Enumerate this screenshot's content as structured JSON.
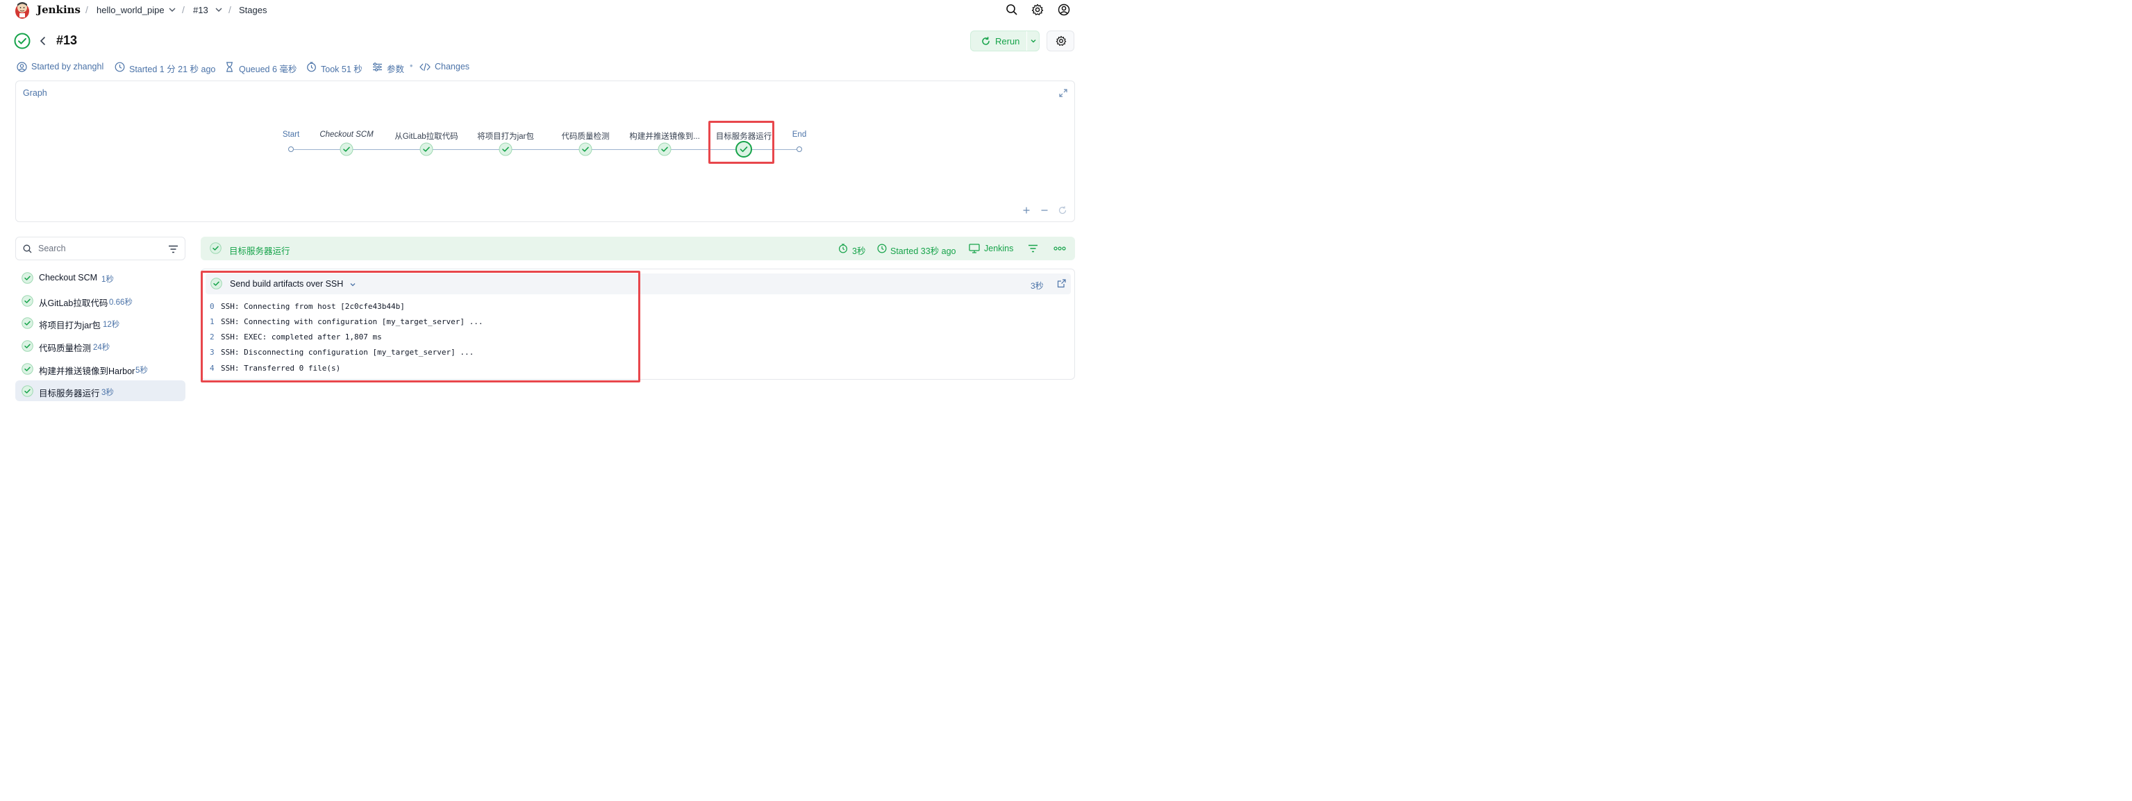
{
  "app": {
    "brand": "Jenkins",
    "breadcrumb": [
      "hello_world_pipe",
      "#13",
      "Stages"
    ]
  },
  "build": {
    "title": "#13",
    "rerun_label": "Rerun",
    "meta": {
      "started_by": "Started by zhanghl",
      "started": "Started 1 分 21 秒 ago",
      "queued": "Queued 6 毫秒",
      "took": "Took 51 秒",
      "params": "参数",
      "changes": "Changes"
    }
  },
  "graph": {
    "title": "Graph",
    "start_label": "Start",
    "end_label": "End",
    "stages": [
      {
        "label": "Checkout SCM",
        "italic": true
      },
      {
        "label": "从GitLab拉取代码"
      },
      {
        "label": "将项目打为jar包"
      },
      {
        "label": "代码质量检测"
      },
      {
        "label": "构建并推送镜像到..."
      },
      {
        "label": "目标服务器运行",
        "selected": true
      }
    ]
  },
  "sidebar": {
    "search_placeholder": "Search",
    "items": [
      {
        "name": "Checkout SCM",
        "duration": "1秒"
      },
      {
        "name": "从GitLab拉取代码",
        "duration": "0.66秒"
      },
      {
        "name": "将项目打为jar包",
        "duration": "12秒"
      },
      {
        "name": "代码质量检测",
        "duration": "24秒"
      },
      {
        "name": "构建并推送镜像到Harbor",
        "duration": "5秒"
      },
      {
        "name": "目标服务器运行",
        "duration": "3秒",
        "active": true
      }
    ]
  },
  "stage_detail": {
    "title": "目标服务器运行",
    "duration": "3秒",
    "started": "Started 33秒 ago",
    "agent": "Jenkins",
    "step": {
      "title": "Send build artifacts over SSH",
      "duration": "3秒",
      "log": [
        {
          "n": "0",
          "text": "SSH: Connecting from host [2c0cfe43b44b]"
        },
        {
          "n": "1",
          "text": "SSH: Connecting with configuration [my_target_server] ..."
        },
        {
          "n": "2",
          "text": "SSH: EXEC: completed after 1,807 ms"
        },
        {
          "n": "3",
          "text": "SSH: Disconnecting configuration [my_target_server] ..."
        },
        {
          "n": "4",
          "text": "SSH: Transferred 0 file(s)"
        }
      ]
    }
  },
  "colors": {
    "success": "#16a34a",
    "accent_link": "#4b73a8",
    "highlight": "#e8474c"
  }
}
